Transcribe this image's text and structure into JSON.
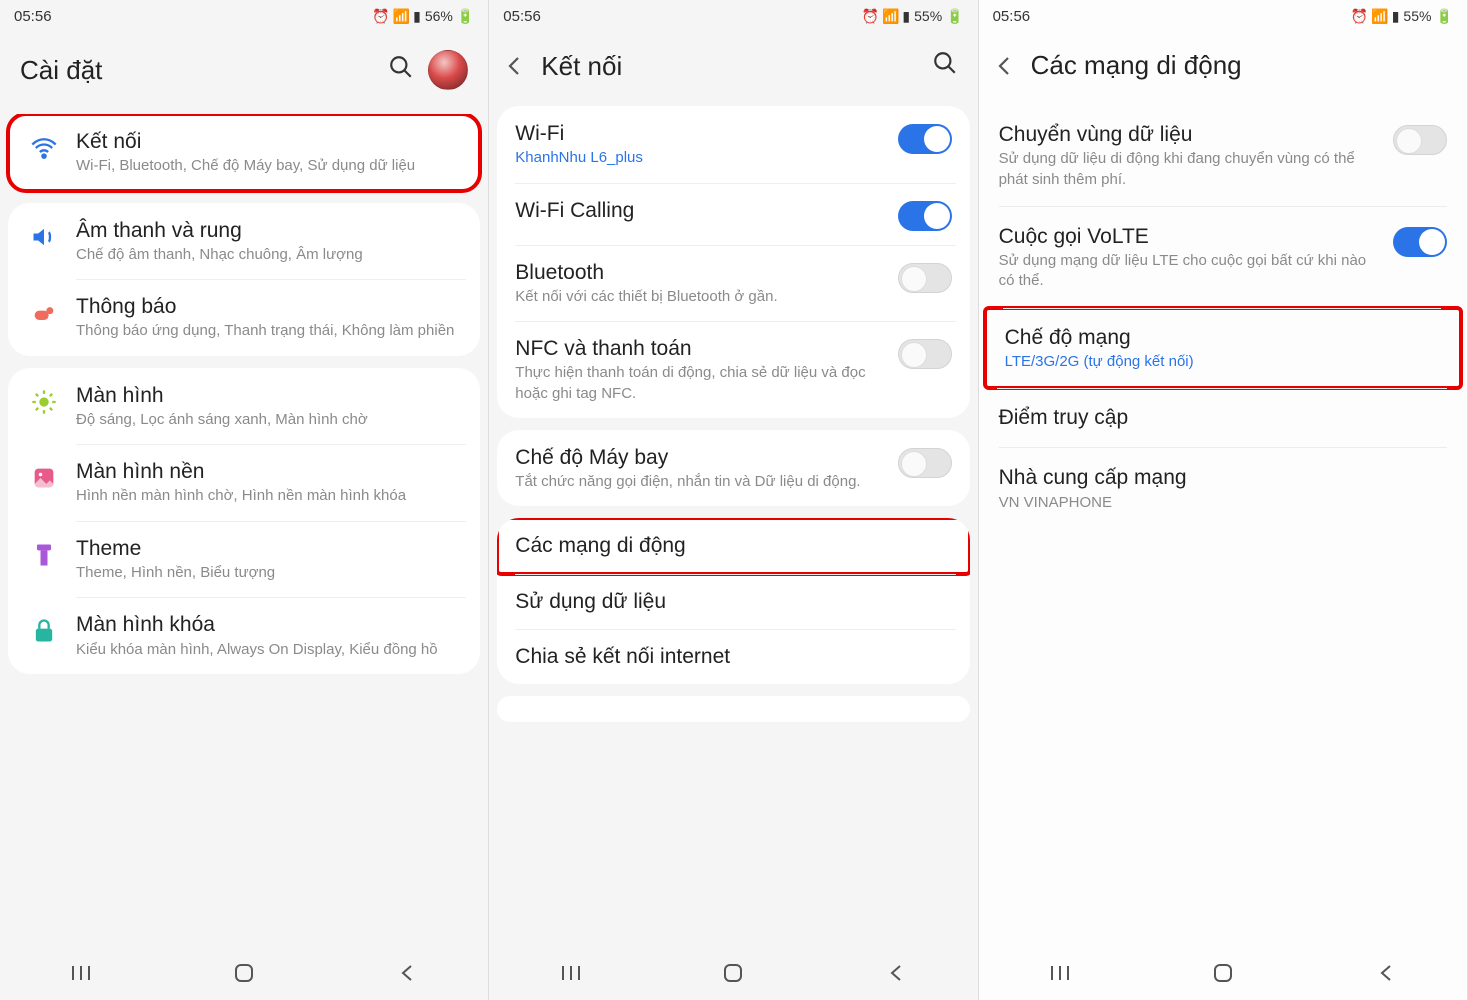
{
  "screens": [
    {
      "status": {
        "time": "05:56",
        "battery": "56%"
      },
      "header": {
        "title": "Cài đặt",
        "back": false,
        "search": true,
        "avatar": true
      },
      "groups": [
        {
          "highlight": true,
          "items": [
            {
              "icon": "wifi",
              "color": "#2a74e8",
              "title": "Kết nối",
              "sub": "Wi-Fi, Bluetooth, Chế độ Máy bay, Sử dụng dữ liệu"
            }
          ]
        },
        {
          "items": [
            {
              "icon": "sound",
              "color": "#2a74e8",
              "title": "Âm thanh và rung",
              "sub": "Chế độ âm thanh, Nhạc chuông, Âm lượng"
            },
            {
              "icon": "notif",
              "color": "#ef6b5c",
              "title": "Thông báo",
              "sub": "Thông báo ứng dụng, Thanh trạng thái, Không làm phiền"
            }
          ]
        },
        {
          "items": [
            {
              "icon": "display",
              "color": "#9acd32",
              "title": "Màn hình",
              "sub": "Độ sáng, Lọc ánh sáng xanh, Màn hình chờ"
            },
            {
              "icon": "wallpaper",
              "color": "#e85a8a",
              "title": "Màn hình nền",
              "sub": "Hình nền màn hình chờ, Hình nền màn hình khóa"
            },
            {
              "icon": "theme",
              "color": "#a858d8",
              "title": "Theme",
              "sub": "Theme, Hình nền, Biểu tượng"
            },
            {
              "icon": "lock",
              "color": "#26b5a0",
              "title": "Màn hình khóa",
              "sub": "Kiểu khóa màn hình, Always On Display, Kiểu đồng hồ"
            }
          ]
        }
      ]
    },
    {
      "status": {
        "time": "05:56",
        "battery": "55%"
      },
      "header": {
        "title": "Kết nối",
        "back": true,
        "search": true,
        "avatar": false
      },
      "groups": [
        {
          "items": [
            {
              "title": "Wi-Fi",
              "sub": "KhanhNhu L6_plus",
              "sublink": true,
              "toggle": "on"
            },
            {
              "title": "Wi-Fi Calling",
              "toggle": "on"
            },
            {
              "title": "Bluetooth",
              "sub": "Kết nối với các thiết bị Bluetooth ở gần.",
              "toggle": "off"
            },
            {
              "title": "NFC và thanh toán",
              "sub": "Thực hiện thanh toán di động, chia sẻ dữ liệu và đọc hoặc ghi tag NFC.",
              "toggle": "off"
            }
          ]
        },
        {
          "items": [
            {
              "title": "Chế độ Máy bay",
              "sub": "Tắt chức năng gọi điện, nhắn tin và Dữ liệu di động.",
              "toggle": "off"
            }
          ]
        },
        {
          "items": [
            {
              "title": "Các mạng di động",
              "highlight": true
            },
            {
              "title": "Sử dụng dữ liệu"
            },
            {
              "title": "Chia sẻ kết nối internet"
            }
          ]
        }
      ]
    },
    {
      "status": {
        "time": "05:56",
        "battery": "55%"
      },
      "header": {
        "title": "Các mạng di động",
        "back": true,
        "search": false,
        "avatar": false
      },
      "rows": [
        {
          "title": "Chuyển vùng dữ liệu",
          "sub": "Sử dụng dữ liệu di động khi đang chuyển vùng có thể phát sinh thêm phí.",
          "toggle": "off"
        },
        {
          "title": "Cuộc gọi VoLTE",
          "sub": "Sử dụng mạng dữ liệu LTE cho cuộc gọi bất cứ khi nào có thể.",
          "toggle": "on"
        },
        {
          "title": "Chế độ mạng",
          "sub": "LTE/3G/2G (tự động kết nối)",
          "sublink": true,
          "highlight": true
        },
        {
          "title": "Điểm truy cập"
        },
        {
          "title": "Nhà cung cấp mạng",
          "sub": "VN VINAPHONE"
        }
      ]
    }
  ]
}
